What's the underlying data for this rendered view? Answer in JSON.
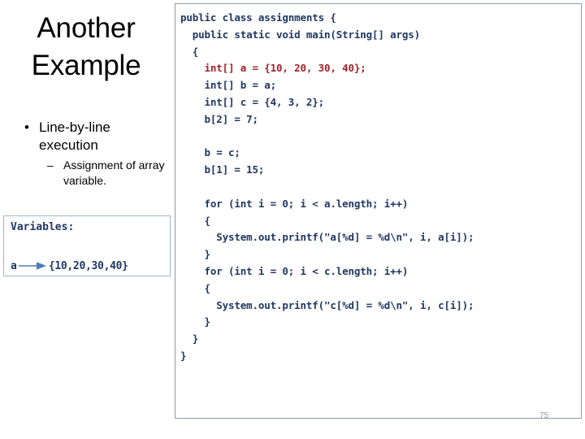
{
  "slide": {
    "title": "Another Example",
    "page_number": "75"
  },
  "bullets": [
    {
      "level": 1,
      "marker": "•",
      "text": "Line-by-line execution"
    },
    {
      "level": 2,
      "marker": "–",
      "text": "Assignment of array variable."
    }
  ],
  "variables_box": {
    "label": "Variables:",
    "rows": [
      {
        "name": "a",
        "arrow": "arrow-right-icon",
        "value": "{10,20,30,40}"
      }
    ]
  },
  "code_panel": {
    "language": "java",
    "lines": [
      {
        "text": "public class assignments {",
        "highlight": false
      },
      {
        "text": "  public static void main(String[] args)",
        "highlight": false
      },
      {
        "text": "  {",
        "highlight": false
      },
      {
        "text": "    int[] a = {10, 20, 30, 40};",
        "highlight": true
      },
      {
        "text": "    int[] b = a;",
        "highlight": false
      },
      {
        "text": "    int[] c = {4, 3, 2};",
        "highlight": false
      },
      {
        "text": "    b[2] = 7;",
        "highlight": false
      },
      {
        "text": "",
        "highlight": false
      },
      {
        "text": "    b = c;",
        "highlight": false
      },
      {
        "text": "    b[1] = 15;",
        "highlight": false
      },
      {
        "text": "",
        "highlight": false
      },
      {
        "text": "    for (int i = 0; i < a.length; i++)",
        "highlight": false
      },
      {
        "text": "    {",
        "highlight": false
      },
      {
        "text": "      System.out.printf(\"a[%d] = %d\\n\", i, a[i]);",
        "highlight": false
      },
      {
        "text": "    }",
        "highlight": false
      },
      {
        "text": "    for (int i = 0; i < c.length; i++)",
        "highlight": false
      },
      {
        "text": "    {",
        "highlight": false
      },
      {
        "text": "      System.out.printf(\"c[%d] = %d\\n\", i, c[i]);",
        "highlight": false
      },
      {
        "text": "    }",
        "highlight": false
      },
      {
        "text": "  }",
        "highlight": false
      },
      {
        "text": "}",
        "highlight": false
      }
    ]
  },
  "colors": {
    "code_text": "#1F3864",
    "code_highlight": "#A02128",
    "arrow": "#4A7EBB",
    "variables_box_border": "#9DB7C9",
    "code_panel_border": "#8C9BA8",
    "page_number": "#9A9A9A",
    "background": "#FFFFFF"
  }
}
